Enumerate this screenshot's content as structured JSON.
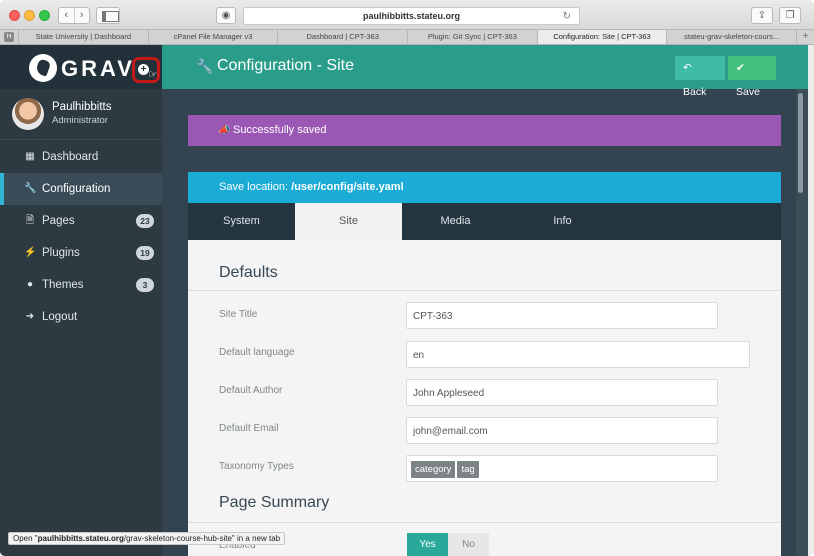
{
  "browser": {
    "url": "paulhibbitts.stateu.org",
    "tabs": [
      {
        "label": "State University | Dashboard",
        "active": false
      },
      {
        "label": "cPanel File Manager v3",
        "active": false
      },
      {
        "label": "Dashboard | CPT-363",
        "active": false
      },
      {
        "label": "Plugin: Git Sync | CPT-363",
        "active": false
      },
      {
        "label": "Configuration: Site | CPT-363",
        "active": true
      },
      {
        "label": "stateu-grav-skeleton-cours...",
        "active": false
      }
    ],
    "tab_icon_letter": "H",
    "status_link": {
      "prefix": "Open \"",
      "url": "paulhibbitts.stateu.org",
      "suffix": "/grav-skeleton-course-hub-site\" in a new tab"
    }
  },
  "sidebar": {
    "brand": "GRAV",
    "user": {
      "name": "Paulhibbitts",
      "role": "Administrator"
    },
    "items": [
      {
        "label": "Dashboard",
        "icon": "grid-icon",
        "badge": "",
        "active": false
      },
      {
        "label": "Configuration",
        "icon": "wrench-icon",
        "badge": "",
        "active": true
      },
      {
        "label": "Pages",
        "icon": "file-icon",
        "badge": "23",
        "active": false
      },
      {
        "label": "Plugins",
        "icon": "plug-icon",
        "badge": "19",
        "active": false
      },
      {
        "label": "Themes",
        "icon": "drop-icon",
        "badge": "3",
        "active": false
      },
      {
        "label": "Logout",
        "icon": "logout-icon",
        "badge": "",
        "active": false
      }
    ]
  },
  "header": {
    "title": "Configuration - Site",
    "back_label": "Back",
    "save_label": "Save"
  },
  "alert": {
    "message": "Successfully saved"
  },
  "save_location": {
    "prefix": "Save location: ",
    "path": "/user/config/site.yaml"
  },
  "form_tabs": [
    {
      "label": "System",
      "active": false
    },
    {
      "label": "Site",
      "active": true
    },
    {
      "label": "Media",
      "active": false
    },
    {
      "label": "Info",
      "active": false
    }
  ],
  "form": {
    "section_defaults": "Defaults",
    "section_summary": "Page Summary",
    "fields": [
      {
        "label": "Site Title",
        "value": "CPT-363"
      },
      {
        "label": "Default language",
        "value": "en"
      },
      {
        "label": "Default Author",
        "value": "John Appleseed"
      },
      {
        "label": "Default Email",
        "value": "john@email.com"
      },
      {
        "label": "Taxonomy Types",
        "tags": [
          "category",
          "tag"
        ]
      }
    ],
    "summary_toggle": {
      "yes": "Yes",
      "no": "No"
    },
    "summary_field_label": "Enabled"
  },
  "colors": {
    "topbar": "#2a9d8a",
    "sidebar": "#2d3a42",
    "alert": "#9a57b4",
    "save_location": "#1aabd6",
    "highlight_ring": "#c51a1a"
  }
}
